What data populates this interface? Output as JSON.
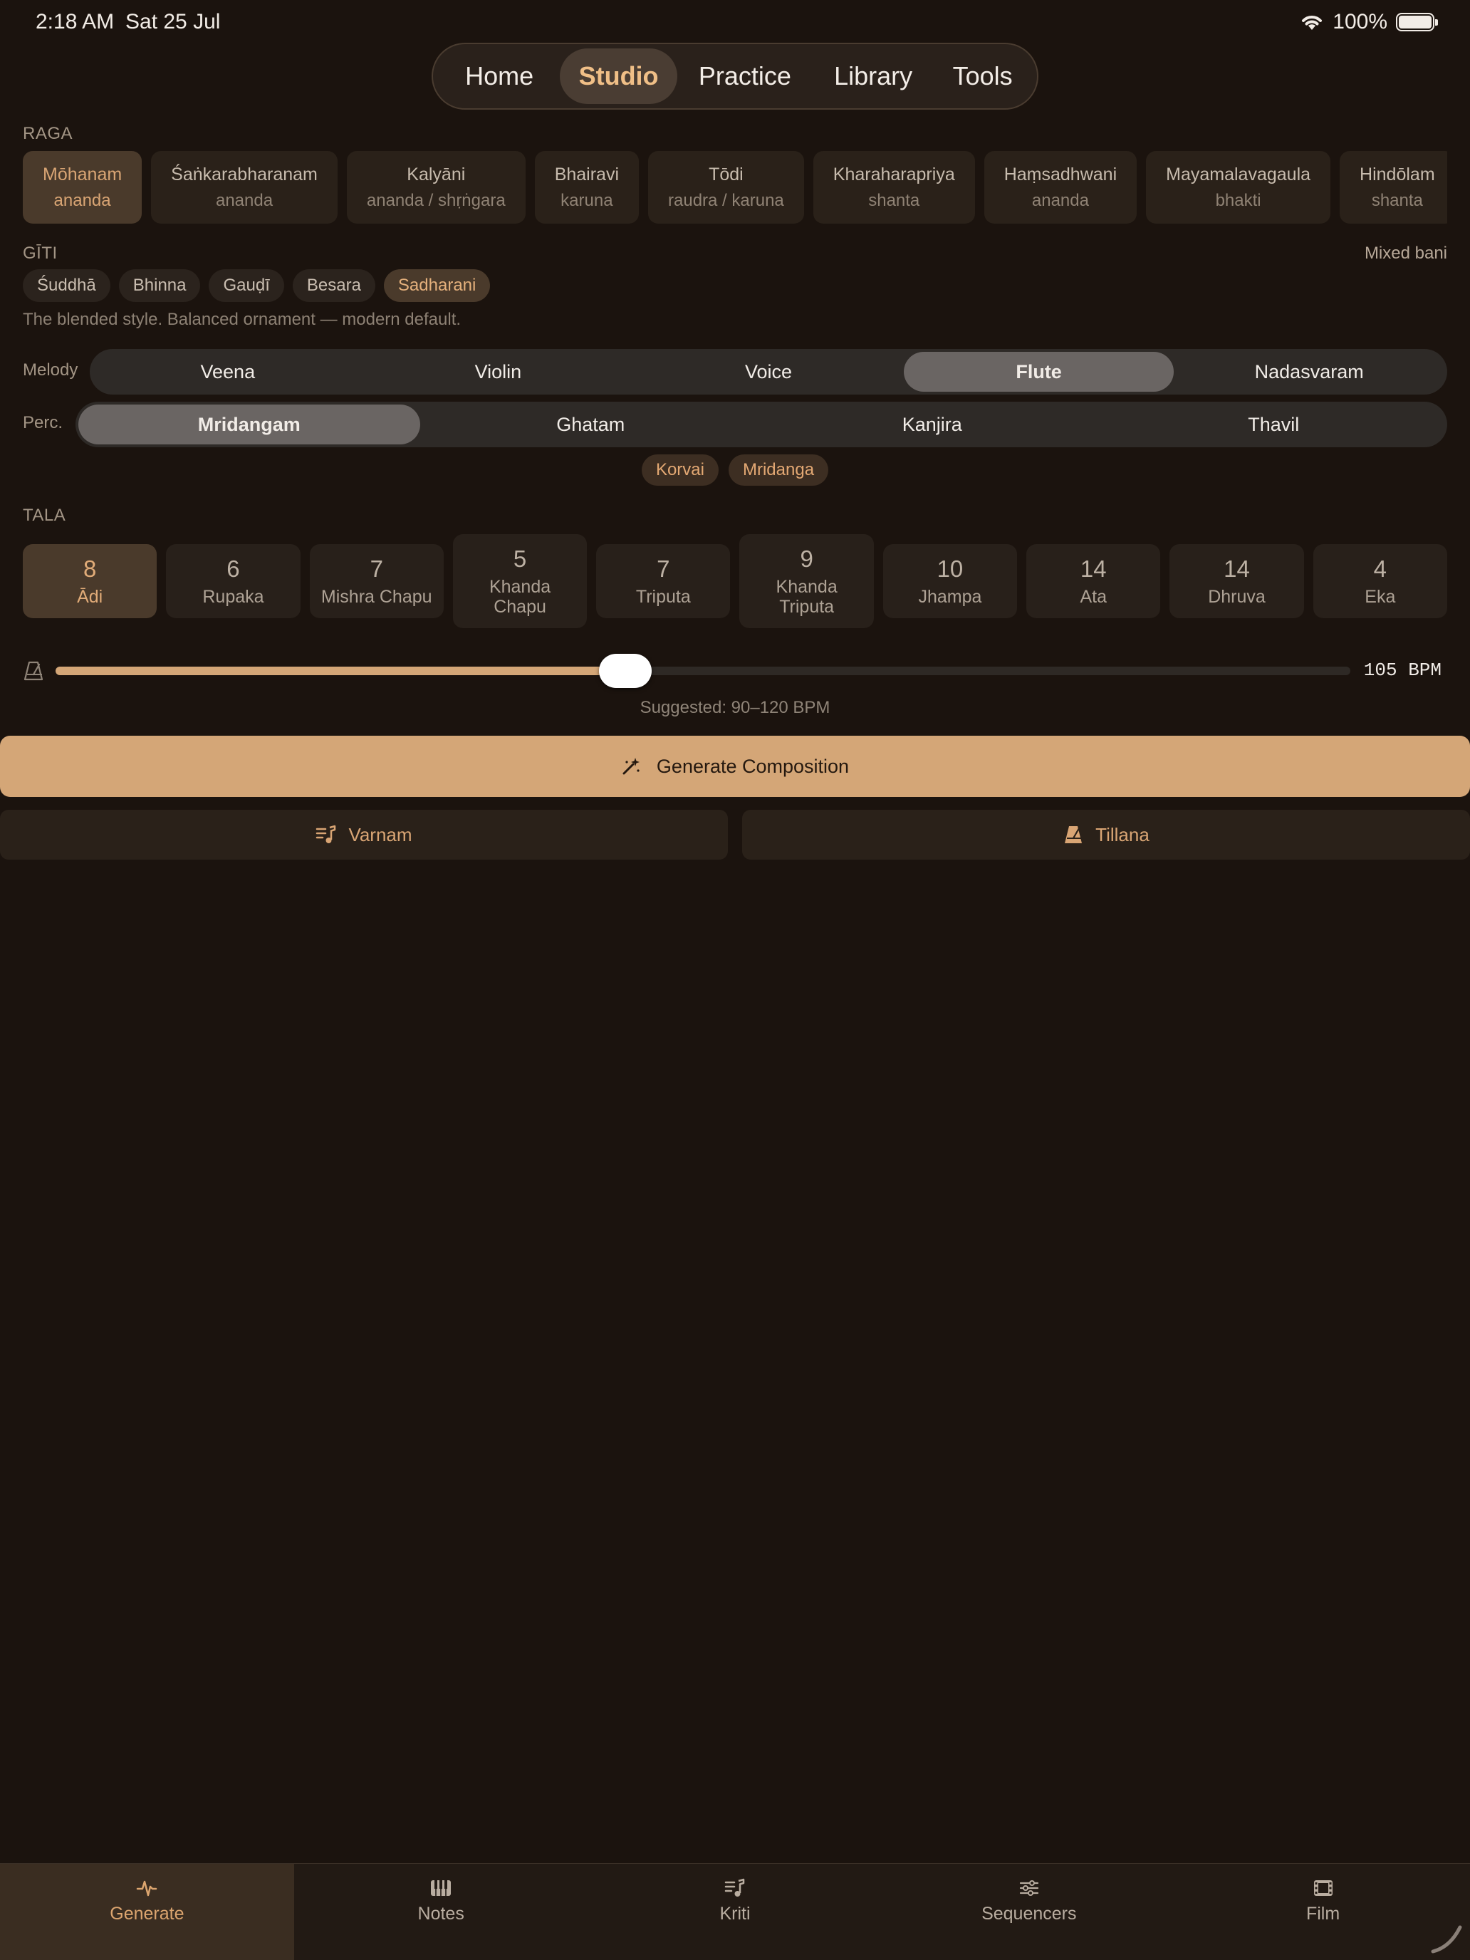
{
  "status": {
    "time": "2:18 AM",
    "date": "Sat 25 Jul",
    "battery": "100%"
  },
  "nav": {
    "tabs": [
      {
        "label": "Home"
      },
      {
        "label": "Studio",
        "active": true
      },
      {
        "label": "Practice"
      },
      {
        "label": "Library"
      },
      {
        "label": "Tools"
      }
    ]
  },
  "raga": {
    "label": "RAGA",
    "items": [
      {
        "name": "Mōhanam",
        "mood": "ananda",
        "active": true
      },
      {
        "name": "Śaṅkarabharanam",
        "mood": "ananda"
      },
      {
        "name": "Kalyāni",
        "mood": "ananda / shṛṅgara"
      },
      {
        "name": "Bhairavi",
        "mood": "karuna"
      },
      {
        "name": "Tōdi",
        "mood": "raudra / karuna"
      },
      {
        "name": "Kharaharapriya",
        "mood": "shanta"
      },
      {
        "name": "Haṃsadhwani",
        "mood": "ananda"
      },
      {
        "name": "Mayamalavagaula",
        "mood": "bhakti"
      },
      {
        "name": "Hindōlam",
        "mood": "shanta"
      }
    ]
  },
  "giti": {
    "label": "GĪTI",
    "right_label": "Mixed bani",
    "options": [
      "Śuddhā",
      "Bhinna",
      "Gauḍī",
      "Besara",
      "Sadharani"
    ],
    "selected": "Sadharani",
    "description": "The blended style. Balanced ornament — modern default."
  },
  "melody": {
    "label": "Melody",
    "options": [
      "Veena",
      "Violin",
      "Voice",
      "Flute",
      "Nadasvaram"
    ],
    "selected": "Flute"
  },
  "perc": {
    "label": "Perc.",
    "options": [
      "Mridangam",
      "Ghatam",
      "Kanjira",
      "Thavil"
    ],
    "selected": "Mridangam"
  },
  "patterns": [
    "Korvai",
    "Mridanga"
  ],
  "tala": {
    "label": "TALA",
    "items": [
      {
        "beats": "8",
        "name": "Ādi",
        "active": true
      },
      {
        "beats": "6",
        "name": "Rupaka"
      },
      {
        "beats": "7",
        "name": "Mishra Chapu"
      },
      {
        "beats": "5",
        "name": "Khanda Chapu",
        "two_line": [
          "Khanda",
          "Chapu"
        ]
      },
      {
        "beats": "7",
        "name": "Triputa"
      },
      {
        "beats": "9",
        "name": "Khanda Triputa",
        "two_line": [
          "Khanda",
          "Triputa"
        ]
      },
      {
        "beats": "10",
        "name": "Jhampa"
      },
      {
        "beats": "14",
        "name": "Ata"
      },
      {
        "beats": "14",
        "name": "Dhruva"
      },
      {
        "beats": "4",
        "name": "Eka"
      }
    ]
  },
  "tempo": {
    "bpm_label": "105 BPM",
    "level": 0.44,
    "suggested": "Suggested: 90–120 BPM"
  },
  "actions": {
    "generate": "Generate Composition",
    "varnam": "Varnam",
    "tillana": "Tillana"
  },
  "colors": {
    "accent": "#d4a677",
    "background": "#1b130e",
    "active_text": "#e0ab78"
  },
  "bottom_tabs": [
    {
      "label": "Generate",
      "icon": "waveform-icon",
      "active": true
    },
    {
      "label": "Notes",
      "icon": "piano-keys-icon"
    },
    {
      "label": "Kriti",
      "icon": "music-list-icon"
    },
    {
      "label": "Sequencers",
      "icon": "sliders-icon"
    },
    {
      "label": "Film",
      "icon": "film-icon"
    }
  ]
}
